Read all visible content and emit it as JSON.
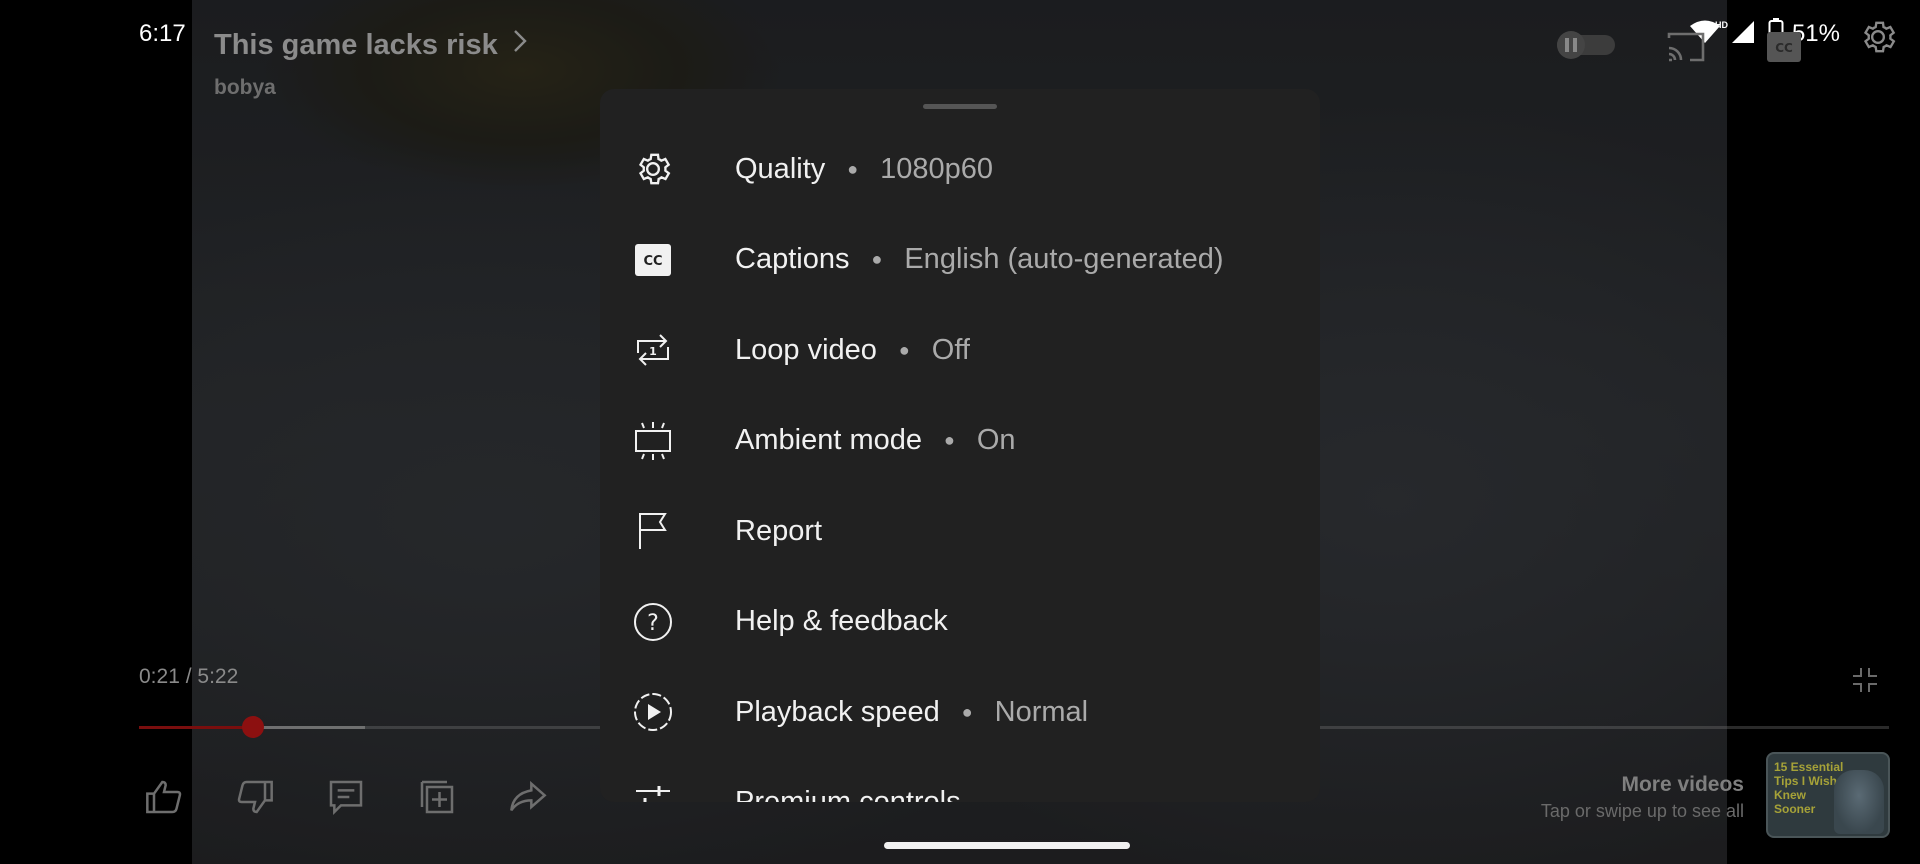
{
  "status_bar": {
    "time": "6:17",
    "battery": "51%",
    "network_badge": "HD"
  },
  "video": {
    "title": "This game lacks risk",
    "channel": "bobya",
    "current_time": "0:21",
    "duration": "5:22",
    "time_separator": " / ",
    "progress_fraction": 0.0652,
    "buffer_fraction": 0.129
  },
  "menu": {
    "items": [
      {
        "icon": "gear-icon",
        "label": "Quality",
        "value": "1080p60"
      },
      {
        "icon": "cc-icon",
        "label": "Captions",
        "value": "English (auto-generated)"
      },
      {
        "icon": "loop-icon",
        "label": "Loop video",
        "value": "Off"
      },
      {
        "icon": "ambient-icon",
        "label": "Ambient mode",
        "value": "On"
      },
      {
        "icon": "flag-icon",
        "label": "Report",
        "value": ""
      },
      {
        "icon": "help-icon",
        "label": "Help & feedback",
        "value": ""
      },
      {
        "icon": "playback-speed-icon",
        "label": "Playback speed",
        "value": "Normal"
      },
      {
        "icon": "sliders-icon",
        "label": "Premium controls",
        "value": ""
      }
    ]
  },
  "more_videos": {
    "title": "More videos",
    "subtitle": "Tap or swipe up to see all",
    "thumbnail_text": "15 Essential Tips I Wish I Knew Sooner"
  },
  "colors": {
    "sheet_bg": "#212121",
    "menu_text": "#f1f1f1",
    "menu_value": "#aaaaaa",
    "progress_red": "#8c1010"
  }
}
